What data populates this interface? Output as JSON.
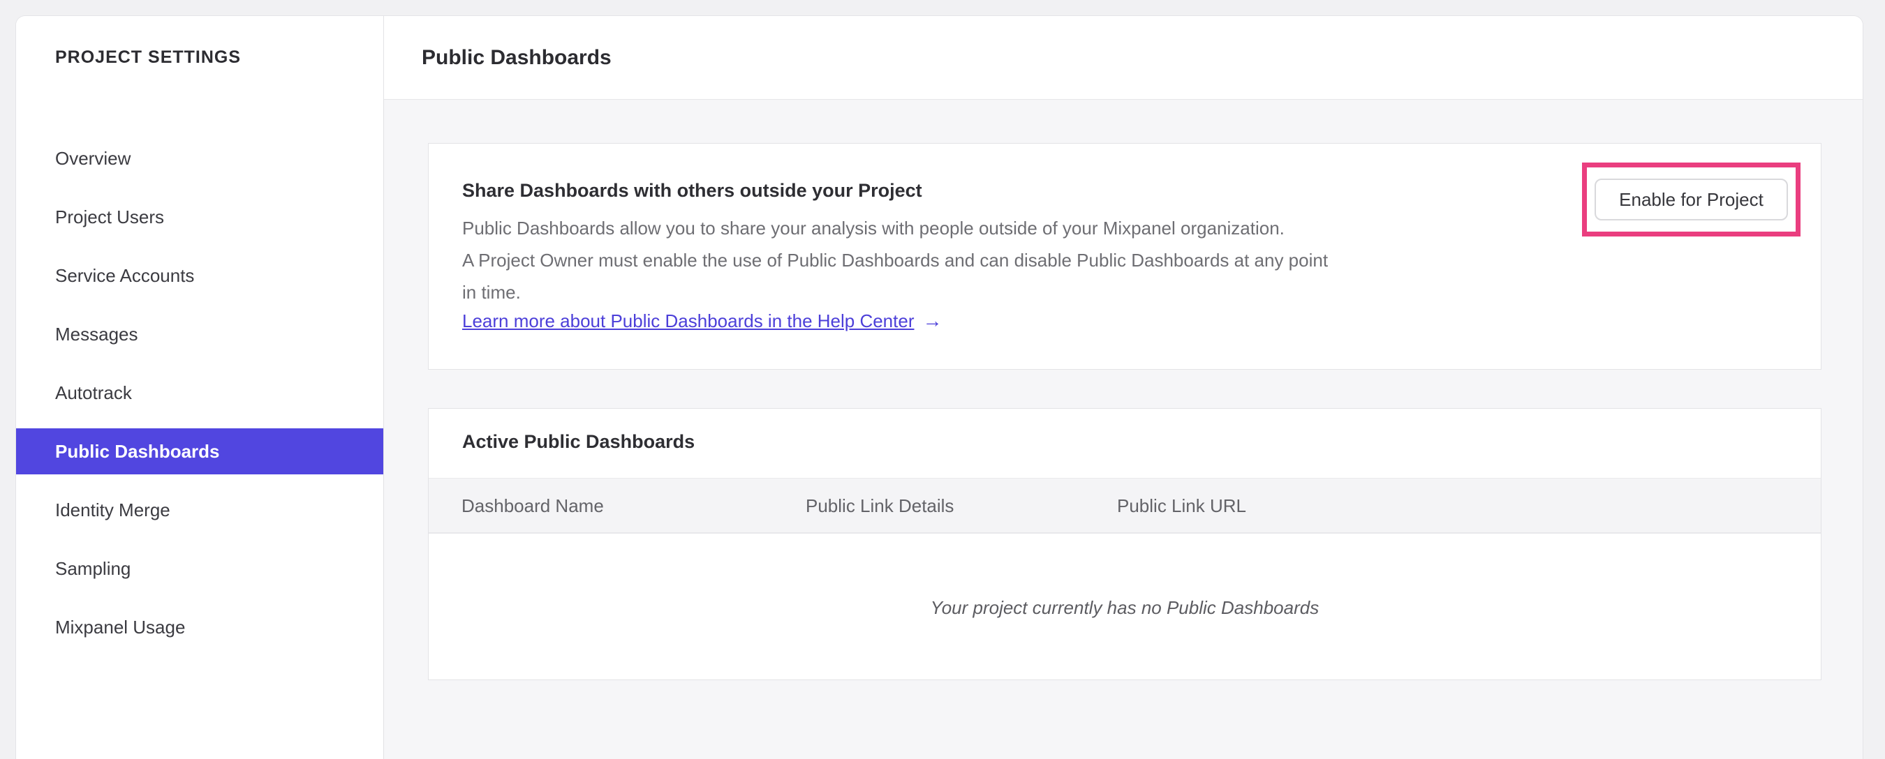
{
  "sidebar": {
    "title": "PROJECT SETTINGS",
    "items": [
      {
        "label": "Overview",
        "selected": false
      },
      {
        "label": "Project Users",
        "selected": false
      },
      {
        "label": "Service Accounts",
        "selected": false
      },
      {
        "label": "Messages",
        "selected": false
      },
      {
        "label": "Autotrack",
        "selected": false
      },
      {
        "label": "Public Dashboards",
        "selected": true
      },
      {
        "label": "Identity Merge",
        "selected": false
      },
      {
        "label": "Sampling",
        "selected": false
      },
      {
        "label": "Mixpanel Usage",
        "selected": false
      }
    ]
  },
  "header": {
    "title": "Public Dashboards"
  },
  "share_card": {
    "heading": "Share Dashboards with others outside your Project",
    "body_lines": [
      "Public Dashboards allow you to share your analysis with people outside of your Mixpanel organization.",
      "A Project Owner must enable the use of Public Dashboards and can disable Public Dashboards at any point",
      "in time."
    ],
    "link_label": "Learn more about Public Dashboards in the Help Center",
    "link_arrow": "→",
    "enable_button_label": "Enable for Project"
  },
  "active_card": {
    "heading": "Active Public Dashboards",
    "columns": [
      "Dashboard Name",
      "Public Link Details",
      "Public Link URL"
    ],
    "empty_message": "Your project currently has no Public Dashboards"
  },
  "colors": {
    "accent_purple": "#5146e0",
    "link_purple": "#4c3fd9",
    "highlight_pink": "#ea3e7f"
  }
}
